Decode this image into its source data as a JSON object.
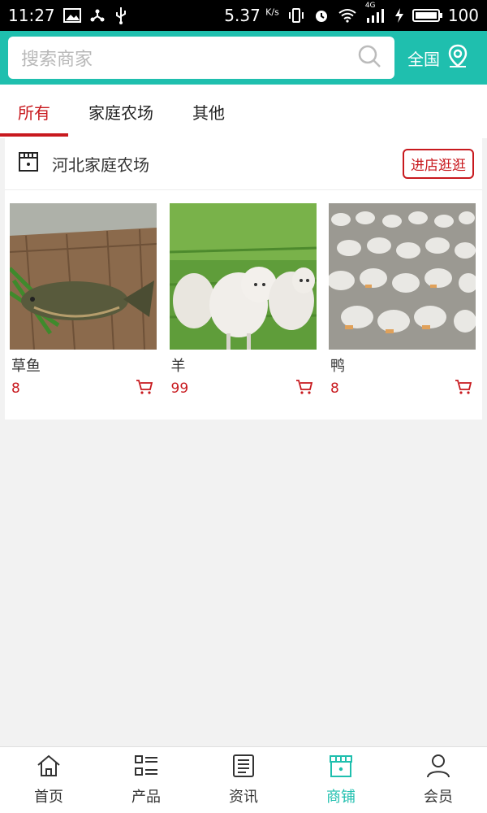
{
  "status_bar": {
    "time": "11:27",
    "speed": "5.37",
    "speed_unit": "K/s",
    "network": "4G",
    "battery": "100"
  },
  "header": {
    "search_placeholder": "搜索商家",
    "region_label": "全国"
  },
  "tabs": [
    {
      "label": "所有",
      "active": true
    },
    {
      "label": "家庭农场",
      "active": false
    },
    {
      "label": "其他",
      "active": false
    }
  ],
  "shop": {
    "name": "河北家庭农场",
    "visit_label": "进店逛逛",
    "products": [
      {
        "name": "草鱼",
        "price": "8"
      },
      {
        "name": "羊",
        "price": "99"
      },
      {
        "name": "鸭",
        "price": "8"
      }
    ]
  },
  "bottom_nav": [
    {
      "label": "首页",
      "icon": "home-icon",
      "active": false
    },
    {
      "label": "产品",
      "icon": "grid-list-icon",
      "active": false
    },
    {
      "label": "资讯",
      "icon": "news-icon",
      "active": false
    },
    {
      "label": "商铺",
      "icon": "store-icon",
      "active": true
    },
    {
      "label": "会员",
      "icon": "user-icon",
      "active": false
    }
  ],
  "colors": {
    "accent": "#1fbfae",
    "primary_red": "#c8191e",
    "background": "#f2f2f2"
  }
}
